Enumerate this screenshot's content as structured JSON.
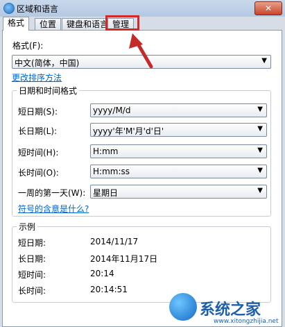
{
  "window": {
    "title": "区域和语言",
    "close_glyph": "✕"
  },
  "tabs": [
    {
      "label": "格式",
      "active": true
    },
    {
      "label": "位置",
      "active": false
    },
    {
      "label": "键盘和语言",
      "active": false
    },
    {
      "label": "管理",
      "active": false
    }
  ],
  "format": {
    "label": "格式(F):",
    "value": "中文(简体，中国)",
    "sort_link": "更改排序方法"
  },
  "datetime": {
    "group_title": "日期和时间格式",
    "rows": [
      {
        "label": "短日期(S):",
        "value": "yyyy/M/d"
      },
      {
        "label": "长日期(L):",
        "value": "yyyy'年'M'月'd'日'"
      },
      {
        "label": "短时间(H):",
        "value": "H:mm"
      },
      {
        "label": "长时间(O):",
        "value": "H:mm:ss"
      },
      {
        "label": "一周的第一天(W):",
        "value": "星期日"
      }
    ],
    "symbols_link": "符号的含意是什么?"
  },
  "example": {
    "group_title": "示例",
    "rows": [
      {
        "label": "短日期:",
        "value": "2014/11/17"
      },
      {
        "label": "长日期:",
        "value": "2014年11月17日"
      },
      {
        "label": "短时间:",
        "value": "20:14"
      },
      {
        "label": "长时间:",
        "value": "20:14:51"
      }
    ]
  },
  "watermark": {
    "text": "系统之家",
    "url": "www.xitongzhijia.net"
  },
  "colors": {
    "highlight": "#d6282a",
    "link": "#0066cc"
  },
  "icons": {
    "dropdown": "▼"
  }
}
